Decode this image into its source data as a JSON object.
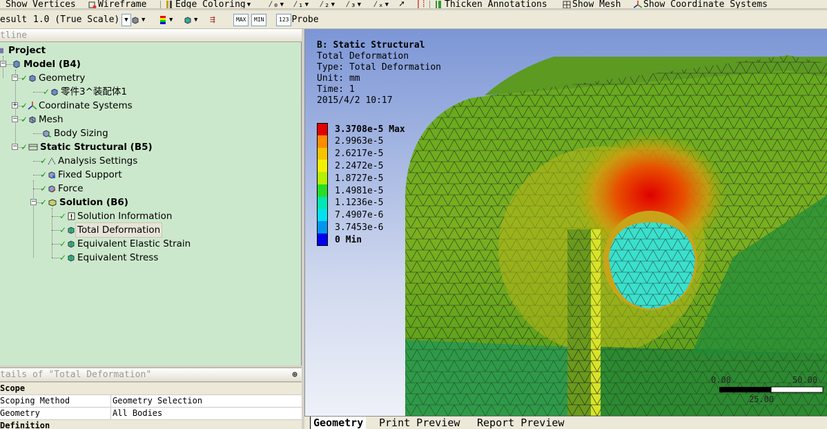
{
  "toolbar1": {
    "show_vertices": "Show Vertices",
    "wireframe": "Wireframe",
    "edge_coloring": "Edge Coloring",
    "thicken_annotations": "Thicken Annotations",
    "show_mesh": "Show Mesh",
    "show_coordinate_systems": "Show Coordinate Systems"
  },
  "toolbar2": {
    "result_label": "esult",
    "scale_value": "1.0 (True Scale)",
    "max_label": "MAX",
    "min_label": "MIN",
    "probe": "Probe"
  },
  "outline": {
    "header": "tline",
    "nodes": [
      {
        "label": "Project"
      },
      {
        "label": "Model (B4)"
      },
      {
        "label": "Geometry"
      },
      {
        "label": "零件3^装配体1"
      },
      {
        "label": "Coordinate Systems"
      },
      {
        "label": "Mesh"
      },
      {
        "label": "Body Sizing"
      },
      {
        "label": "Static Structural (B5)"
      },
      {
        "label": "Analysis Settings"
      },
      {
        "label": "Fixed Support"
      },
      {
        "label": "Force"
      },
      {
        "label": "Solution (B6)"
      },
      {
        "label": "Solution Information"
      },
      {
        "label": "Total Deformation"
      },
      {
        "label": "Equivalent Elastic Strain"
      },
      {
        "label": "Equivalent Stress"
      }
    ]
  },
  "details": {
    "header": "tails of \"Total Deformation\"",
    "pin": "⊕",
    "rows": [
      {
        "key": "Scope",
        "value": ""
      },
      {
        "key": "Scoping Method",
        "value": "Geometry Selection"
      },
      {
        "key": "Geometry",
        "value": "All Bodies"
      },
      {
        "key": "Definition",
        "value": ""
      }
    ]
  },
  "viewport": {
    "title": "B: Static Structural",
    "info": [
      "Total Deformation",
      "Type: Total Deformation",
      "Unit: mm",
      "Time: 1",
      "2015/4/2 10:17"
    ],
    "legend": [
      {
        "label": "3.3708e-5 Max",
        "color": "#e00000"
      },
      {
        "label": "2.9963e-5",
        "color": "#ff8c00"
      },
      {
        "label": "2.6217e-5",
        "color": "#f5c400"
      },
      {
        "label": "2.2472e-5",
        "color": "#f2f200"
      },
      {
        "label": "1.8727e-5",
        "color": "#b4f000"
      },
      {
        "label": "1.4981e-5",
        "color": "#28dc28"
      },
      {
        "label": "1.1236e-5",
        "color": "#00e6b4"
      },
      {
        "label": "7.4907e-6",
        "color": "#00e1f0"
      },
      {
        "label": "3.7453e-6",
        "color": "#0096f0"
      },
      {
        "label": "0 Min",
        "color": "#0000ee"
      }
    ],
    "scale_ticks": [
      "0.00",
      "50.00",
      "25.00"
    ]
  },
  "tabs": [
    "Geometry",
    "Print Preview",
    "Report Preview"
  ]
}
